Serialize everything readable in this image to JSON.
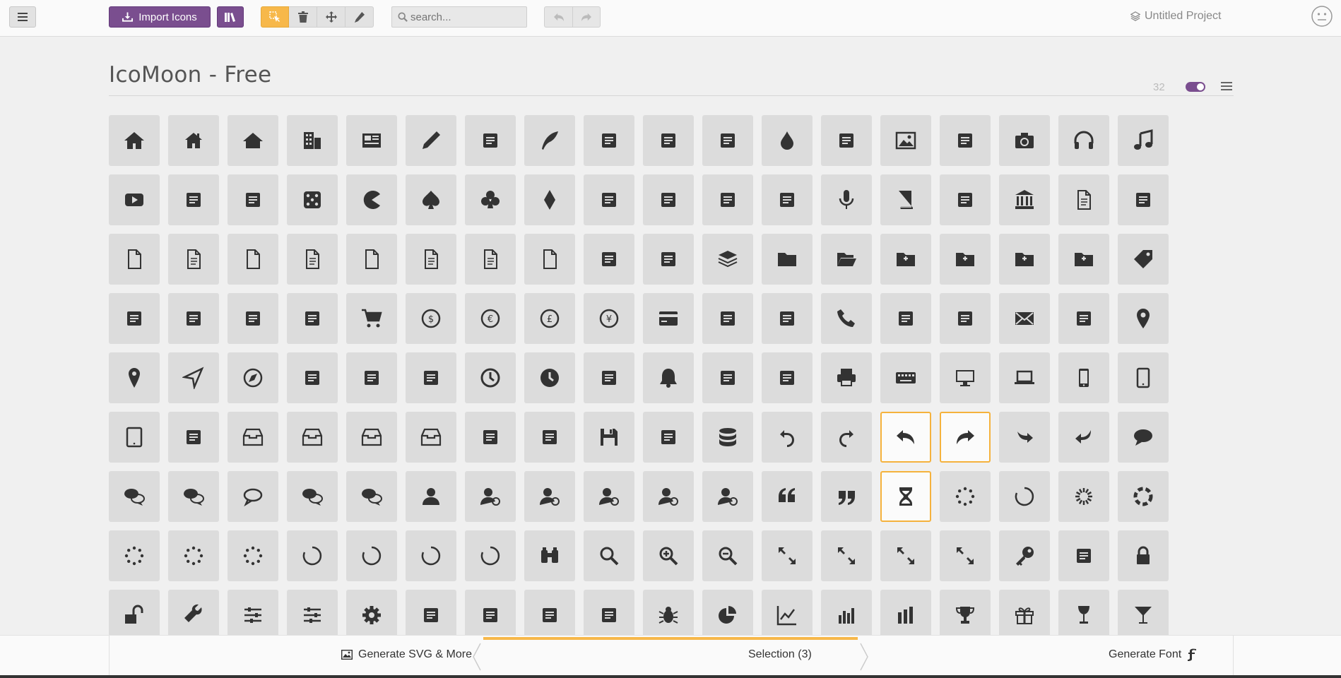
{
  "toolbar": {
    "import_label": "Import Icons",
    "search_placeholder": "search...",
    "project_name": "Untitled Project"
  },
  "icon_set": {
    "title": "IcoMoon - Free",
    "count": "32"
  },
  "colors": {
    "brand": "#7a4e8f",
    "accent": "#f7b84a",
    "tile": "#dcdcdc",
    "icon": "#333333"
  },
  "icons": [
    "home",
    "home2",
    "home3",
    "office",
    "newspaper",
    "pencil",
    "pencil2",
    "quill",
    "pen",
    "blog",
    "eyedropper",
    "droplet",
    "paint-format",
    "image",
    "images",
    "camera",
    "headphones",
    "music",
    "play",
    "film",
    "video-camera",
    "dice",
    "pacman",
    "spades",
    "clubs",
    "diamonds",
    "bullhorn",
    "connection",
    "podcast",
    "feed",
    "mic",
    "book",
    "books",
    "library",
    "file-text",
    "profile",
    "file-empty",
    "files-empty",
    "file-text2",
    "file-picture",
    "file-music",
    "file-play",
    "file-video",
    "file-zip",
    "copy",
    "paste",
    "stack",
    "folder",
    "folder-open",
    "folder-plus",
    "folder-minus",
    "folder-download",
    "folder-upload",
    "price-tag",
    "price-tags",
    "barcode",
    "qrcode",
    "ticket",
    "cart",
    "coin-dollar",
    "coin-euro",
    "coin-pound",
    "coin-yen",
    "credit-card",
    "calculator",
    "lifebuoy",
    "phone",
    "phone-hang-up",
    "address-book",
    "envelop",
    "pushpin",
    "location",
    "location2",
    "compass",
    "compass2",
    "map",
    "map2",
    "history",
    "clock",
    "clock2",
    "alarm",
    "bell",
    "stopwatch",
    "calendar",
    "printer",
    "keyboard",
    "display",
    "laptop",
    "mobile",
    "mobile2",
    "tablet",
    "tv",
    "drawer",
    "drawer2",
    "box-add",
    "box-remove",
    "download",
    "upload",
    "floppy-disk",
    "drive",
    "database",
    "undo",
    "redo",
    "undo2",
    "redo2",
    "forward",
    "reply",
    "bubble",
    "bubbles",
    "bubbles2",
    "bubble2",
    "bubbles3",
    "bubbles4",
    "user",
    "users",
    "user-plus",
    "user-minus",
    "user-check",
    "user-tie",
    "quotes-left",
    "quotes-right",
    "hour-glass",
    "spinner",
    "spinner2",
    "spinner3",
    "spinner4",
    "spinner5",
    "spinner6",
    "spinner7",
    "spinner8",
    "spinner9",
    "spinner10",
    "spinner11",
    "binoculars",
    "search",
    "zoom-in",
    "zoom-out",
    "enlarge",
    "shrink",
    "enlarge2",
    "shrink2",
    "key",
    "key2",
    "lock",
    "unlocked",
    "wrench",
    "equalizer",
    "equalizer2",
    "cog",
    "cogs",
    "hammer",
    "magic-wand",
    "aid-kit",
    "bug",
    "pie-chart",
    "stats-dots",
    "stats-bars",
    "stats-bars2",
    "trophy",
    "gift",
    "glass",
    "glass2"
  ],
  "selected_icons": [
    "undo2",
    "redo2",
    "hour-glass"
  ],
  "bottom": {
    "generate_svg": "Generate SVG & More",
    "selection": "Selection (3)",
    "generate_font": "Generate Font"
  }
}
